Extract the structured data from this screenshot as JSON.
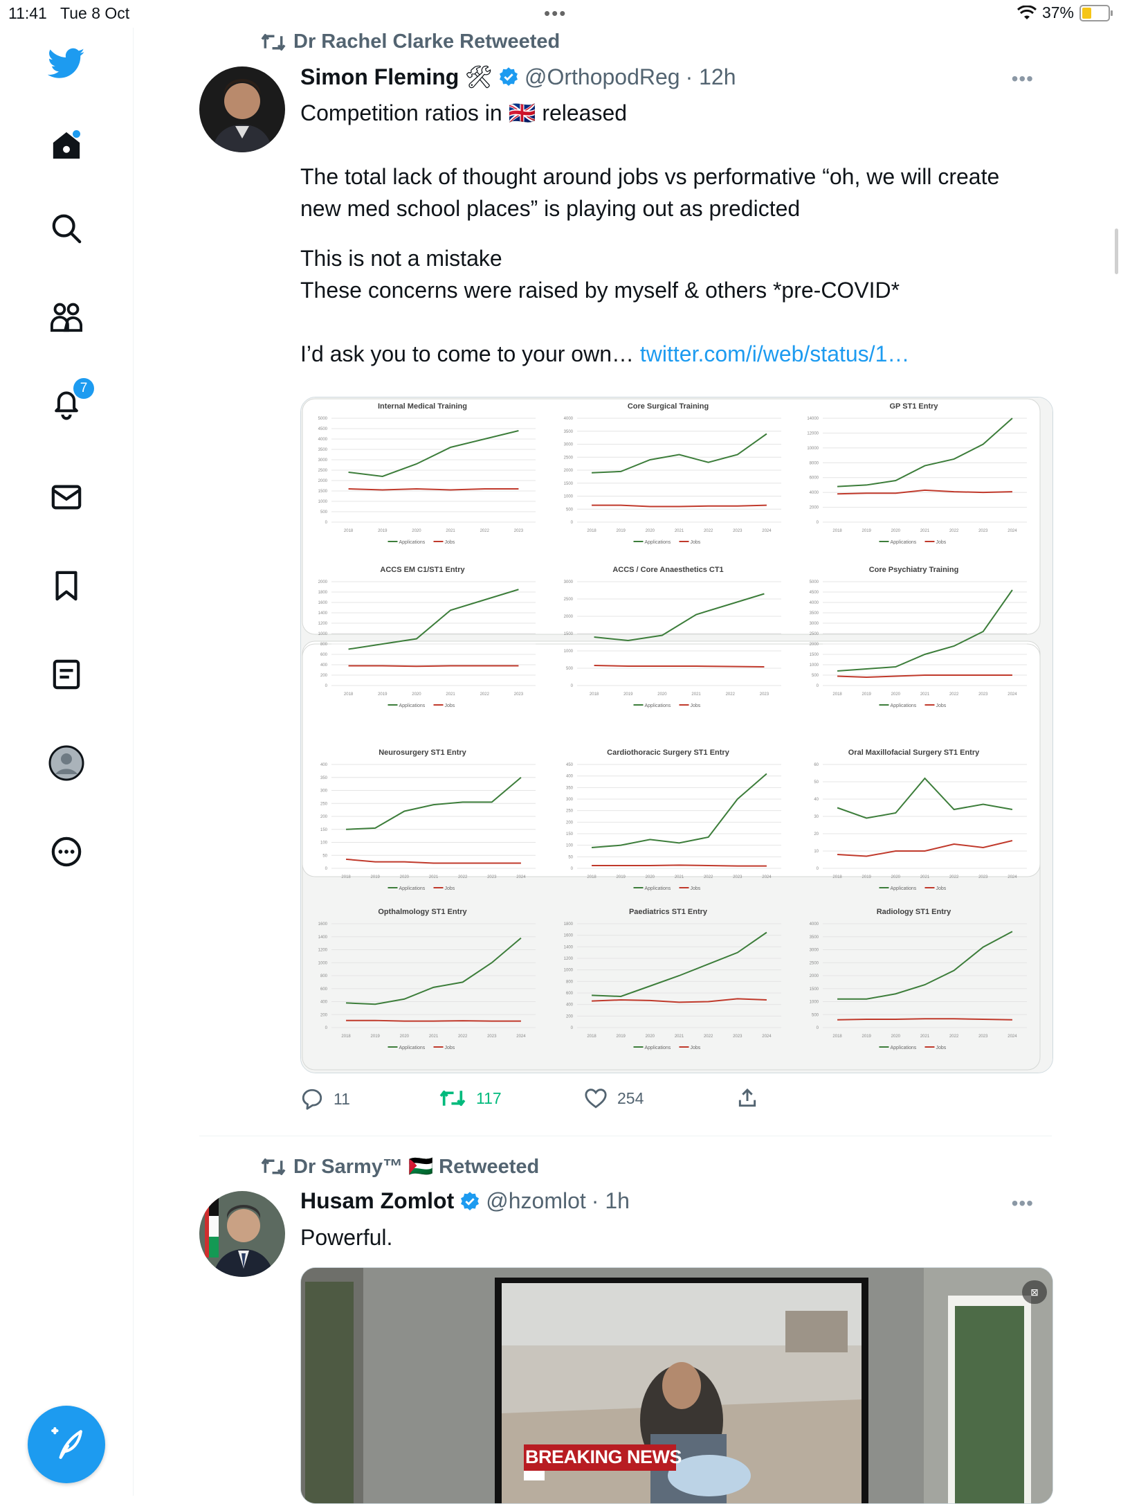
{
  "status_bar": {
    "time": "11:41",
    "date": "Tue 8 Oct",
    "battery": "37%",
    "battery_level": 0.37
  },
  "sidebar": {
    "items": [
      {
        "icon": "twitter-logo-icon"
      },
      {
        "icon": "home-icon",
        "has_dot": true
      },
      {
        "icon": "search-icon"
      },
      {
        "icon": "communities-icon"
      },
      {
        "icon": "notifications-icon",
        "badge": "7"
      },
      {
        "icon": "messages-icon"
      },
      {
        "icon": "bookmarks-icon"
      },
      {
        "icon": "lists-icon"
      },
      {
        "icon": "profile-icon"
      },
      {
        "icon": "more-icon"
      }
    ],
    "compose_icon": "compose-tweet-icon"
  },
  "tweets": [
    {
      "retweeted_by": "Dr Rachel Clarke Retweeted",
      "name": "Simon Fleming",
      "name_emoji": "🛠",
      "handle": "@OrthopodReg",
      "time": "· 12h",
      "text_line1": "Competition ratios in",
      "flag": "🇬🇧",
      "text_line1_end": "released",
      "paragraph2": "The total lack of thought around jobs vs performative “oh, we will create new med school places” is playing out as predicted",
      "paragraph3a": "This is not a mistake",
      "paragraph3b": "These concerns were raised by myself & others *pre-COVID*",
      "paragraph4": "I’d ask you to come to your own…",
      "link": "twitter.com/i/web/status/1…",
      "replies": "11",
      "retweets": "117",
      "likes": "254"
    },
    {
      "retweeted_by": "Dr Sarmy™ 🇵🇸 Retweeted",
      "name": "Husam Zomlot",
      "handle": "@hzomlot",
      "time": "· 1h",
      "text": "Powerful.",
      "video_caption": "BREAKING NEWS"
    }
  ],
  "chart_data": [
    {
      "type": "line",
      "title": "Internal Medical Training",
      "x": [
        "2018",
        "2019",
        "2020",
        "2021",
        "2022",
        "2023"
      ],
      "ylim": [
        0,
        5000
      ],
      "yticks": [
        "5000",
        "4500",
        "4000",
        "3500",
        "3000",
        "2500",
        "2000",
        "1500",
        "1000",
        "500",
        "0"
      ],
      "series": [
        {
          "name": "Applications",
          "values": [
            2400,
            2200,
            2800,
            3600,
            4000,
            4400
          ]
        },
        {
          "name": "Jobs",
          "values": [
            1600,
            1550,
            1600,
            1550,
            1600,
            1600
          ]
        }
      ]
    },
    {
      "type": "line",
      "title": "Core Surgical Training",
      "x": [
        "2018",
        "2019",
        "2020",
        "2021",
        "2022",
        "2023",
        "2024"
      ],
      "ylim": [
        0,
        4000
      ],
      "yticks": [
        "4000",
        "3500",
        "3000",
        "2500",
        "2000",
        "1500",
        "1000",
        "500",
        "0"
      ],
      "series": [
        {
          "name": "Applications",
          "values": [
            1900,
            1950,
            2400,
            2600,
            2300,
            2600,
            3400
          ]
        },
        {
          "name": "Jobs",
          "values": [
            650,
            650,
            600,
            600,
            620,
            620,
            650
          ]
        }
      ]
    },
    {
      "type": "line",
      "title": "GP ST1 Entry",
      "x": [
        "2018",
        "2019",
        "2020",
        "2021",
        "2022",
        "2023",
        "2024"
      ],
      "ylim": [
        0,
        14000
      ],
      "yticks": [
        "14000",
        "12000",
        "10000",
        "8000",
        "6000",
        "4000",
        "2000",
        "0"
      ],
      "series": [
        {
          "name": "Applications",
          "values": [
            4800,
            5000,
            5600,
            7600,
            8500,
            10500,
            14000
          ]
        },
        {
          "name": "Jobs",
          "values": [
            3800,
            3900,
            3900,
            4300,
            4100,
            4000,
            4100
          ]
        }
      ]
    },
    {
      "type": "line",
      "title": "ACCS EM C1/ST1 Entry",
      "x": [
        "2018",
        "2019",
        "2020",
        "2021",
        "2022",
        "2023"
      ],
      "ylim": [
        0,
        2000
      ],
      "yticks": [
        "2000",
        "1800",
        "1600",
        "1400",
        "1200",
        "1000",
        "800",
        "600",
        "400",
        "200",
        "0"
      ],
      "series": [
        {
          "name": "Applications",
          "values": [
            700,
            800,
            900,
            1450,
            1650,
            1850
          ]
        },
        {
          "name": "Jobs",
          "values": [
            380,
            380,
            370,
            380,
            380,
            380
          ]
        }
      ]
    },
    {
      "type": "line",
      "title": "ACCS / Core Anaesthetics CT1",
      "x": [
        "2018",
        "2019",
        "2020",
        "2021",
        "2022",
        "2023"
      ],
      "ylim": [
        0,
        3000
      ],
      "yticks": [
        "3000",
        "2500",
        "2000",
        "1500",
        "1000",
        "500",
        "0"
      ],
      "series": [
        {
          "name": "Applications",
          "values": [
            1400,
            1300,
            1450,
            2050,
            2350,
            2650
          ]
        },
        {
          "name": "Jobs",
          "values": [
            580,
            560,
            560,
            560,
            550,
            540
          ]
        }
      ]
    },
    {
      "type": "line",
      "title": "Core Psychiatry Training",
      "x": [
        "2018",
        "2019",
        "2020",
        "2021",
        "2022",
        "2023",
        "2024"
      ],
      "ylim": [
        0,
        5000
      ],
      "yticks": [
        "5000",
        "4500",
        "4000",
        "3500",
        "3000",
        "2500",
        "2000",
        "1500",
        "1000",
        "500",
        "0"
      ],
      "series": [
        {
          "name": "Applications",
          "values": [
            700,
            800,
            900,
            1500,
            1900,
            2600,
            4600
          ]
        },
        {
          "name": "Jobs",
          "values": [
            450,
            400,
            450,
            500,
            500,
            500,
            500
          ]
        }
      ]
    },
    {
      "type": "line",
      "title": "Neurosurgery ST1 Entry",
      "x": [
        "2018",
        "2019",
        "2020",
        "2021",
        "2022",
        "2023",
        "2024"
      ],
      "ylim": [
        0,
        400
      ],
      "yticks": [
        "400",
        "350",
        "300",
        "250",
        "200",
        "150",
        "100",
        "50",
        "0"
      ],
      "series": [
        {
          "name": "Applications",
          "values": [
            150,
            155,
            220,
            245,
            255,
            255,
            350
          ]
        },
        {
          "name": "Jobs",
          "values": [
            35,
            25,
            25,
            20,
            20,
            20,
            20
          ]
        }
      ]
    },
    {
      "type": "line",
      "title": "Cardiothoracic Surgery ST1 Entry",
      "x": [
        "2018",
        "2019",
        "2020",
        "2021",
        "2022",
        "2023",
        "2024"
      ],
      "ylim": [
        0,
        450
      ],
      "yticks": [
        "450",
        "400",
        "350",
        "300",
        "250",
        "200",
        "150",
        "100",
        "50",
        "0"
      ],
      "series": [
        {
          "name": "Applications",
          "values": [
            90,
            100,
            125,
            110,
            135,
            300,
            410
          ]
        },
        {
          "name": "Jobs",
          "values": [
            12,
            12,
            12,
            14,
            12,
            10,
            10
          ]
        }
      ]
    },
    {
      "type": "line",
      "title": "Oral Maxillofacial Surgery ST1 Entry",
      "x": [
        "2018",
        "2019",
        "2020",
        "2021",
        "2022",
        "2023",
        "2024"
      ],
      "ylim": [
        0,
        60
      ],
      "yticks": [
        "60",
        "50",
        "40",
        "30",
        "20",
        "10",
        "0"
      ],
      "series": [
        {
          "name": "Applications",
          "values": [
            35,
            29,
            32,
            52,
            34,
            37,
            34
          ]
        },
        {
          "name": "Jobs",
          "values": [
            8,
            7,
            10,
            10,
            14,
            12,
            16
          ]
        }
      ]
    },
    {
      "type": "line",
      "title": "Opthalmology ST1 Entry",
      "x": [
        "2018",
        "2019",
        "2020",
        "2021",
        "2022",
        "2023",
        "2024"
      ],
      "ylim": [
        0,
        1600
      ],
      "yticks": [
        "1600",
        "1400",
        "1200",
        "1000",
        "800",
        "600",
        "400",
        "200",
        "0"
      ],
      "series": [
        {
          "name": "Applications",
          "values": [
            380,
            360,
            440,
            620,
            700,
            1000,
            1380
          ]
        },
        {
          "name": "Jobs",
          "values": [
            110,
            110,
            100,
            100,
            105,
            100,
            100
          ]
        }
      ]
    },
    {
      "type": "line",
      "title": "Paediatrics ST1 Entry",
      "x": [
        "2018",
        "2019",
        "2020",
        "2021",
        "2022",
        "2023",
        "2024"
      ],
      "ylim": [
        0,
        1800
      ],
      "yticks": [
        "1800",
        "1600",
        "1400",
        "1200",
        "1000",
        "800",
        "600",
        "400",
        "200",
        "0"
      ],
      "series": [
        {
          "name": "Applications",
          "values": [
            560,
            540,
            720,
            900,
            1100,
            1300,
            1650
          ]
        },
        {
          "name": "Jobs",
          "values": [
            460,
            480,
            470,
            440,
            450,
            500,
            480
          ]
        }
      ]
    },
    {
      "type": "line",
      "title": "Radiology ST1 Entry",
      "x": [
        "2018",
        "2019",
        "2020",
        "2021",
        "2022",
        "2023",
        "2024"
      ],
      "ylim": [
        0,
        4000
      ],
      "yticks": [
        "4000",
        "3500",
        "3000",
        "2500",
        "2000",
        "1500",
        "1000",
        "500",
        "0"
      ],
      "series": [
        {
          "name": "Applications",
          "values": [
            1100,
            1100,
            1300,
            1650,
            2200,
            3100,
            3700
          ]
        },
        {
          "name": "Jobs",
          "values": [
            300,
            320,
            320,
            340,
            340,
            320,
            300
          ]
        }
      ]
    }
  ],
  "colors": {
    "accent": "#1d9bf0",
    "retweet_green": "#00ba7c",
    "applications_line": "#3c7d3a",
    "jobs_line": "#c0392b"
  }
}
